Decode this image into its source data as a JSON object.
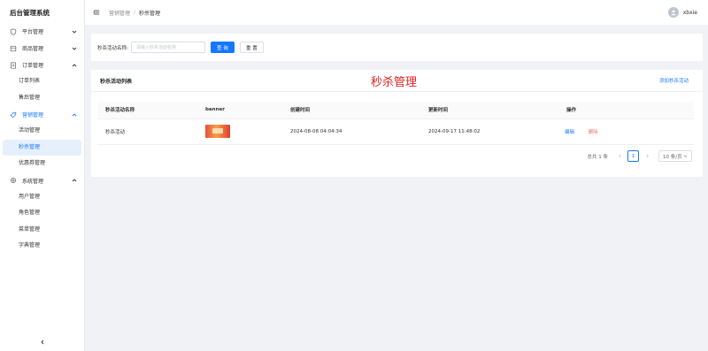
{
  "app": {
    "title": "后台管理系统"
  },
  "sidebar": {
    "items": [
      {
        "label": "平台管理",
        "icon": "shield-icon",
        "expanded": false,
        "sub": []
      },
      {
        "label": "商品管理",
        "icon": "shop-icon",
        "expanded": false,
        "sub": []
      },
      {
        "label": "订单管理",
        "icon": "document-icon",
        "expanded": true,
        "sub": [
          "订单列表",
          "售后管理"
        ]
      },
      {
        "label": "营销管理",
        "icon": "tag-icon",
        "expanded": true,
        "sub": [
          "活动管理",
          "秒杀管理",
          "优惠券管理"
        ]
      },
      {
        "label": "系统管理",
        "icon": "gear-icon",
        "expanded": true,
        "sub": [
          "用户管理",
          "角色管理",
          "菜单管理",
          "字典管理"
        ]
      }
    ]
  },
  "header": {
    "breadcrumb": [
      "营销管理",
      "秒杀管理"
    ],
    "username": "xbxie"
  },
  "search": {
    "label": "秒杀活动名称:",
    "placeholder": "请输入秒杀活动名称",
    "query_label": "查 询",
    "reset_label": "重 置"
  },
  "list": {
    "title": "秒杀活动列表",
    "big_title": "秒杀管理",
    "add_label": "添加秒杀活动",
    "columns": [
      "秒杀活动名称",
      "banner",
      "创建时间",
      "更新时间",
      "操作"
    ],
    "rows": [
      {
        "name": "秒杀活动",
        "created": "2024-08-08 04:04:34",
        "updated": "2024-09-17 11:48:02",
        "edit": "编辑",
        "delete": "删除"
      }
    ]
  },
  "pagination": {
    "total": "总共 1 条",
    "current_page": "1",
    "page_size": "10 条/页"
  },
  "colors": {
    "primary": "#1677ff",
    "danger": "#f56c6c",
    "title_red": "#e02020"
  }
}
